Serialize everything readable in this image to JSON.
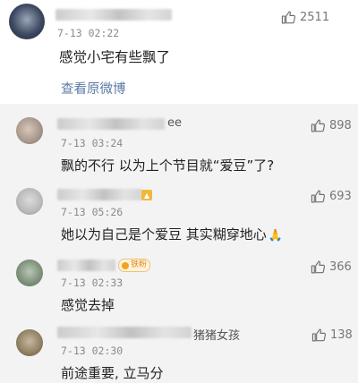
{
  "main_comment": {
    "timestamp": "7-13 02:22",
    "text": "感觉小宅有些飘了",
    "view_original": "查看原微博",
    "likes": "2511"
  },
  "replies": [
    {
      "name_suffix": "ee",
      "timestamp": "7-13 03:24",
      "text": "飘的不行 以为上个节目就“爱豆”了?",
      "likes": "898"
    },
    {
      "timestamp": "7-13 05:26",
      "text": "她以为自己是个爱豆 其实糊穿地心",
      "emoji_icon": "hands-emoji",
      "likes": "693"
    },
    {
      "badge": "铁粉",
      "timestamp": "7-13 02:33",
      "text": "感觉去掉",
      "likes": "366"
    },
    {
      "name_suffix": "猪猪女孩",
      "timestamp": "7-13 02:30",
      "text": "前途重要, 立马分",
      "likes": "138"
    }
  ],
  "colors": {
    "link": "#5b7aa6",
    "reply_background": "#f3f3f3",
    "badge": "#f0a41d"
  }
}
